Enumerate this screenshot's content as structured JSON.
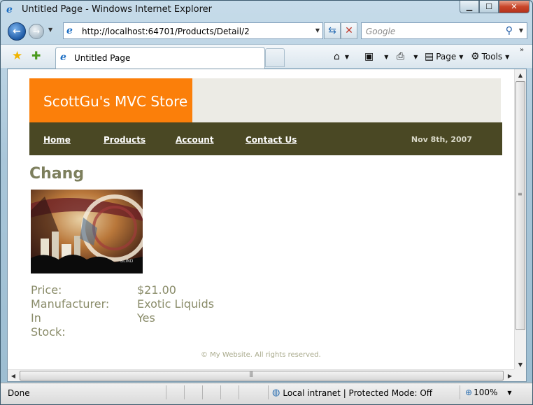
{
  "window": {
    "title": "Untitled Page - Windows Internet Explorer",
    "minimize_glyph": "▁",
    "maximize_glyph": "☐",
    "close_glyph": "✕"
  },
  "address_bar": {
    "url": "http://localhost:64701/Products/Detail/2",
    "search_placeholder": "Google"
  },
  "tab": {
    "label": "Untitled Page"
  },
  "commands": {
    "page_label": "Page",
    "tools_label": "Tools"
  },
  "site": {
    "logo": "ScottGu's MVC Store",
    "nav": [
      {
        "label": "Home"
      },
      {
        "label": "Products"
      },
      {
        "label": "Account"
      },
      {
        "label": "Contact Us"
      }
    ],
    "date": "Nov 8th, 2007",
    "footer": "© My Website. All rights reserved."
  },
  "product": {
    "name": "Chang",
    "image_caption": "BLIND",
    "fields": [
      {
        "label": "Price:",
        "value": "$21.00"
      },
      {
        "label": "Manufacturer:",
        "value": "Exotic Liquids"
      },
      {
        "label": "In Stock:",
        "value": "Yes"
      }
    ]
  },
  "status_bar": {
    "status": "Done",
    "zone": "Local intranet | Protected Mode: Off",
    "zoom": "100%"
  },
  "colors": {
    "logo_bg": "#fb7f0a",
    "menu_bg": "#4a4824",
    "header_bg": "#ecebe5",
    "title_color": "#7d7f5d",
    "detail_color": "#8a8c6a"
  },
  "icons": [
    "ie-logo-icon",
    "back-arrow-icon",
    "forward-arrow-icon",
    "refresh-icon",
    "stop-icon",
    "search-icon",
    "favorites-star-icon",
    "add-favorites-icon",
    "home-icon",
    "feeds-icon",
    "print-icon",
    "page-icon",
    "tools-gear-icon",
    "globe-zone-icon",
    "zoom-icon"
  ]
}
